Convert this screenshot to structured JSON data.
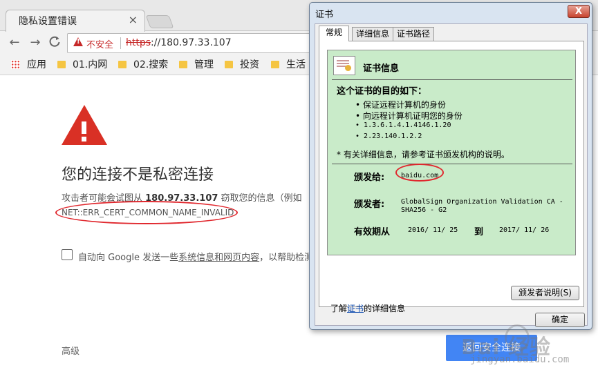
{
  "browser": {
    "tab_title": "隐私设置错误",
    "tab_close": "×",
    "omnibox": {
      "security_label": "不安全",
      "url_scheme": "https",
      "url_rest": "://180.97.33.107"
    },
    "nav": {
      "back": "←",
      "forward": "→",
      "reload": "C"
    },
    "bookmarks": [
      {
        "label": "应用"
      },
      {
        "label": "01.内网"
      },
      {
        "label": "02.搜索"
      },
      {
        "label": "管理"
      },
      {
        "label": "投资"
      },
      {
        "label": "生活"
      }
    ]
  },
  "error_page": {
    "title": "您的连接不是私密连接",
    "desc_prefix": "攻击者可能会试图从 ",
    "desc_host": "180.97.33.107",
    "desc_suffix": " 窃取您的信息（例如",
    "error_code": "NET::ERR_CERT_COMMON_NAME_INVALID",
    "checkbox_label_prefix": "自动向 Google 发送一些",
    "checkbox_label_link": "系统信息和网页内容",
    "checkbox_label_suffix": "，以帮助检测",
    "advanced_label": "高级",
    "back_button_label": "返回安全连接"
  },
  "certificate_dialog": {
    "title": "证书",
    "close_label": "X",
    "tabs": [
      "常规",
      "详细信息",
      "证书路径"
    ],
    "info_title": "证书信息",
    "purpose_heading": "这个证书的目的如下：",
    "purposes": [
      "保证远程计算机的身份",
      "向远程计算机证明您的身份",
      "1.3.6.1.4.1.4146.1.20",
      "2.23.140.1.2.2"
    ],
    "note": "* 有关详细信息，请参考证书颁发机构的说明。",
    "issued_to_label": "颁发给:",
    "issued_to_value": "baidu.com",
    "issued_by_label": "颁发者:",
    "issued_by_value_line1": "GlobalSign Organization Validation CA -",
    "issued_by_value_line2": "SHA256 - G2",
    "validity_label": "有效期从",
    "validity_from": "2016/ 11/ 25",
    "validity_to_label": "到",
    "validity_to": "2017/ 11/ 26",
    "issuer_statement_button": "颁发者说明(S)",
    "learn_prefix": "了解",
    "learn_link": "证书",
    "learn_suffix": "的详细信息",
    "ok_button": "确定"
  },
  "watermark": {
    "logo": "Bai  经验",
    "site": "jingyan.baidu.com"
  }
}
